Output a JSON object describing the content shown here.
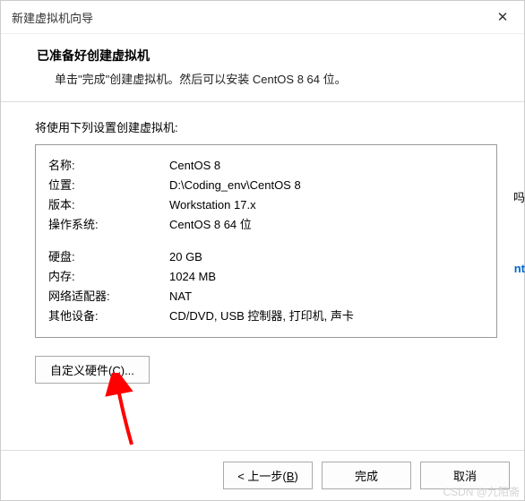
{
  "titlebar": {
    "title": "新建虚拟机向导",
    "close": "✕"
  },
  "header": {
    "title": "已准备好创建虚拟机",
    "subtitle": "单击\"完成\"创建虚拟机。然后可以安装 CentOS 8 64 位。"
  },
  "settings": {
    "intro": "将使用下列设置创建虚拟机:",
    "rows1": [
      {
        "key": "名称:",
        "val": "CentOS 8"
      },
      {
        "key": "位置:",
        "val": "D:\\Coding_env\\CentOS 8"
      },
      {
        "key": "版本:",
        "val": "Workstation 17.x"
      },
      {
        "key": "操作系统:",
        "val": "CentOS 8 64 位"
      }
    ],
    "rows2": [
      {
        "key": "硬盘:",
        "val": "20 GB"
      },
      {
        "key": "内存:",
        "val": "1024 MB"
      },
      {
        "key": "网络适配器:",
        "val": "NAT"
      },
      {
        "key": "其他设备:",
        "val": "CD/DVD, USB 控制器, 打印机, 声卡"
      }
    ]
  },
  "buttons": {
    "customize_pre": "自定义硬件(",
    "customize_key": "C",
    "customize_post": ")...",
    "back_pre": "< 上一步(",
    "back_key": "B",
    "back_post": ")",
    "finish": "完成",
    "cancel": "取消"
  },
  "watermark": "CSDN @九陌斋",
  "frag1": "吗",
  "frag2": "nt"
}
